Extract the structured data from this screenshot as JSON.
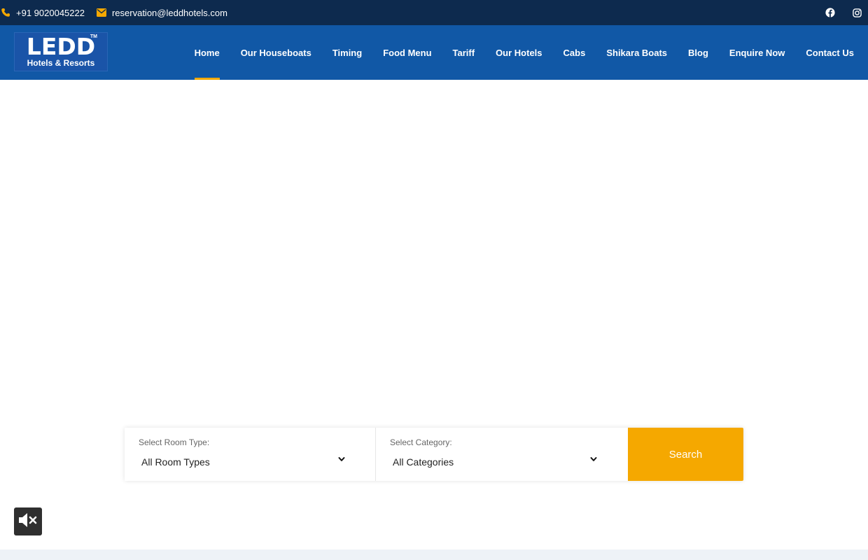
{
  "topbar": {
    "phone_icon": "phone-icon",
    "phone": "+91 9020045222",
    "email_icon": "envelope-icon",
    "email": "reservation@leddhotels.com",
    "social": [
      "facebook-icon",
      "instagram-icon"
    ]
  },
  "logo": {
    "brand": "LEDD",
    "tagline": "Hotels & Resorts",
    "tm": "TM"
  },
  "nav": {
    "items": [
      {
        "label": "Home",
        "active": true
      },
      {
        "label": "Our Houseboats"
      },
      {
        "label": "Timing"
      },
      {
        "label": "Food Menu"
      },
      {
        "label": "Tariff"
      },
      {
        "label": "Our Hotels"
      },
      {
        "label": "Cabs"
      },
      {
        "label": "Shikara Boats"
      },
      {
        "label": "Blog"
      },
      {
        "label": "Enquire Now"
      },
      {
        "label": "Contact Us"
      }
    ]
  },
  "search": {
    "room_type_label": "Select Room Type:",
    "room_type_value": "All Room Types",
    "category_label": "Select Category:",
    "category_value": "All Categories",
    "button_label": "Search"
  },
  "video": {
    "mute_icon": "volume-mute-icon"
  },
  "colors": {
    "topbar_bg": "#0d2a4e",
    "nav_bg": "#1158a6",
    "accent": "#f5a800"
  }
}
